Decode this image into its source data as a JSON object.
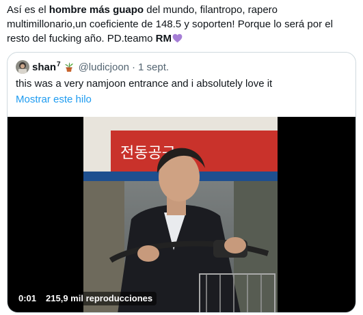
{
  "tweet": {
    "text_pre": "Así es el ",
    "text_bold": "hombre más guapo",
    "text_mid": " del mundo, filantropo, rapero multimillonario,un coeficiente de 148.5 y soporten! Porque lo será por el resto del fucking año. PD.teamo ",
    "text_rm": "RM",
    "emoji": "purple-heart-icon"
  },
  "quote": {
    "name": "shan",
    "name_sup": "7",
    "handle": "@ludicjoon",
    "separator": "·",
    "date": "1 sept.",
    "text": "this was a very namjoon entrance and i absolutely love it",
    "thread_link": "Mostrar este hilo"
  },
  "video": {
    "time": "0:01",
    "views": "215,9 mil reproducciones",
    "sign_text": "전동공구"
  },
  "colors": {
    "link": "#1d9bf0",
    "secondary_text": "#536471",
    "border": "#cfd9de",
    "heart": "#a67ed6"
  }
}
